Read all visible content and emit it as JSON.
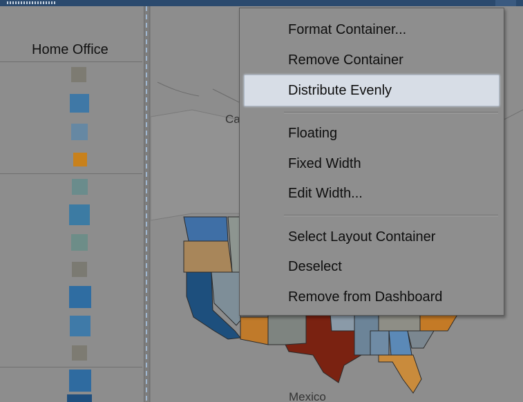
{
  "left_panel": {
    "header": "Home Office",
    "swatch_colors": [
      "#7d7b72",
      "#3f78a6",
      "#6688a3",
      "#c8811c",
      "#6a8c8c",
      "#3c7ba3",
      "#6d8d88",
      "#7b7a72",
      "#2f6da2",
      "#3f7aa8",
      "#7d7b72",
      "#2f6ba0",
      "#1f4f7e"
    ]
  },
  "map": {
    "label_canada": "Ca",
    "label_mexico": "Mexico",
    "state_colors": {
      "washington": "#3f6fa6",
      "oregon": "#a8865a",
      "idaho": "#8d9590",
      "california": "#1d4f7d",
      "nevada": "#7e8e98",
      "arizona": "#c07a2a",
      "texas": "#7a2211",
      "south": "#6c8498",
      "georgia": "#5b89b7",
      "florida": "#c98b3c",
      "carolina": "#c47a26"
    }
  },
  "context_menu": {
    "items": [
      {
        "label": "Format Container..."
      },
      {
        "label": "Remove Container"
      },
      {
        "label": "Distribute Evenly",
        "highlighted": true
      },
      {
        "label": "Floating"
      },
      {
        "label": "Fixed Width"
      },
      {
        "label": "Edit Width..."
      },
      {
        "label": "Select Layout Container"
      },
      {
        "label": "Deselect"
      },
      {
        "label": "Remove from Dashboard"
      }
    ]
  }
}
